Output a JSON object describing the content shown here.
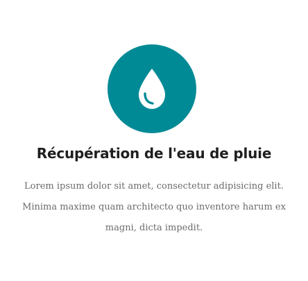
{
  "feature": {
    "icon": "water-drop-icon",
    "accent_color": "#008a96",
    "title": "Récupération de l'eau de pluie",
    "description": "Lorem ipsum dolor sit amet, consectetur adipisicing elit. Minima maxime quam architecto quo inventore harum ex magni, dicta impedit."
  }
}
